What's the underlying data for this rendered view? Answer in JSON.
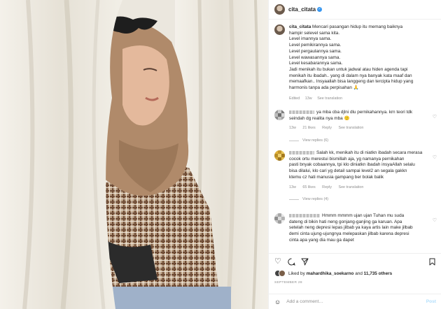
{
  "post": {
    "username": "cita_citata",
    "caption_lines": [
      "Mencari pasangan hidup itu memang baiknya",
      "hampir selevel sama kita.",
      "Level imannya sama.",
      "Level pemikirannya sama.",
      "Level pergaulannya sama.",
      "Level wawasannya sama.",
      "Level kesabarannya sama.",
      "Jadi menikah itu bukan untuk jadwal atau hiden agenda tapi",
      "menikah itu ibadah.. yang di dalam nya banyak kata maaf dan",
      "memaafkan.. Insyaallah bisa langgeng dan tercipta hidup yang",
      "harmonis tanpa ada perpisahan 🙏"
    ],
    "edited": "Edited",
    "age": "13w",
    "see_translation": "See translation"
  },
  "comments": [
    {
      "lines": [
        "ya mba cba djlni dlu pernikahannya. krn teori tdk",
        "seindah dg realita nya mba 🙂"
      ],
      "age": "13w",
      "likes": "21 likes",
      "reply": "Reply",
      "see_translation": "See translation",
      "view_replies": "View replies (6)"
    },
    {
      "lines": [
        "Salah kk, menikah itu di niatkn ibadah secara merasa",
        "cocok ortu merestui bismillah aja, yg namanya pernikahan",
        "pasti bnyak cobaannya, tpi klo diniatkn ibadah insyaAllah selalu",
        "bisa dilalui, klo cari yg detail sampai level2 an segala gakkn",
        "ktemu cz hati manusia gampang ber bolak balik"
      ],
      "age": "13w",
      "likes": "65 likes",
      "reply": "Reply",
      "see_translation": "See translation",
      "view_replies": "View replies (4)"
    },
    {
      "lines": [
        "Hmmm mmmm ujan ujan Tuhan mu suda",
        "dateng di bikin hati neng gonjang-ganjing ga karuan. Apa",
        "setelah neng depresi lepas jilbab ya kaya artis lain make jilbab",
        "demi cinta ujung-ujungnya melepaskan jilbab karena depresi",
        "cinta apa yang dia mau ga dapet"
      ]
    }
  ],
  "likes": {
    "prefix": "Liked by",
    "user": "mahardhika_soekarno",
    "joiner": "and",
    "others": "11,735 others"
  },
  "date": "SEPTEMBER 28",
  "add_comment": {
    "placeholder": "Add a comment…",
    "post": "Post"
  },
  "icons": {
    "heart": "heart-icon",
    "comment": "comment-icon",
    "share": "share-icon",
    "bookmark": "bookmark-icon",
    "emoji": "emoji-icon",
    "verified": "verified-badge-icon"
  },
  "colors": {
    "link": "#3897f0",
    "muted": "#8e8e8e",
    "post_disabled": "#b2dffc"
  }
}
